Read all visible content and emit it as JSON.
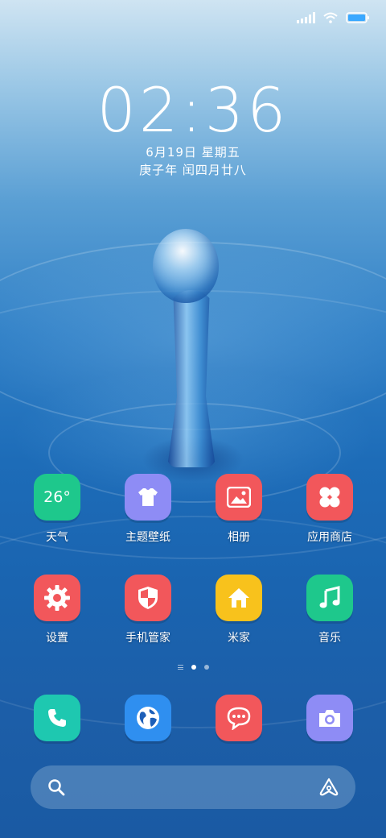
{
  "status_bar": {
    "signal_icon": "signal-icon",
    "wifi_icon": "wifi-icon",
    "battery_icon": "battery-icon",
    "battery_color": "#3aa8ff"
  },
  "lock": {
    "time": "02:36",
    "date_line": "6月19日 星期五",
    "lunar_line": "庚子年 闰四月廿八"
  },
  "apps_row1": [
    {
      "label": "天气",
      "color": "#1ec88c",
      "icon": "weather-icon",
      "icon_text": "26°"
    },
    {
      "label": "主题壁纸",
      "color": "#8e8cf5",
      "icon": "tshirt-icon"
    },
    {
      "label": "相册",
      "color": "#f2575b",
      "icon": "gallery-icon"
    },
    {
      "label": "应用商店",
      "color": "#f2575b",
      "icon": "clover-icon"
    }
  ],
  "apps_row2": [
    {
      "label": "设置",
      "color": "#f2575b",
      "icon": "gear-icon"
    },
    {
      "label": "手机管家",
      "color": "#f2575b",
      "icon": "shield-icon"
    },
    {
      "label": "米家",
      "color": "#f8c21c",
      "icon": "home-icon"
    },
    {
      "label": "音乐",
      "color": "#1ec88c",
      "icon": "music-note-icon"
    }
  ],
  "dock": [
    {
      "name": "phone",
      "color": "#1ec8b0",
      "icon": "phone-icon"
    },
    {
      "name": "browser",
      "color": "#2f8ff0",
      "icon": "globe-icon"
    },
    {
      "name": "messages",
      "color": "#f2575b",
      "icon": "message-bubble-icon"
    },
    {
      "name": "camera",
      "color": "#8e8cf5",
      "icon": "camera-icon"
    }
  ],
  "page_indicator": {
    "pages": 2,
    "current": 1
  },
  "search_bar": {
    "search_icon": "search-icon",
    "assistant_icon": "assistant-icon"
  }
}
